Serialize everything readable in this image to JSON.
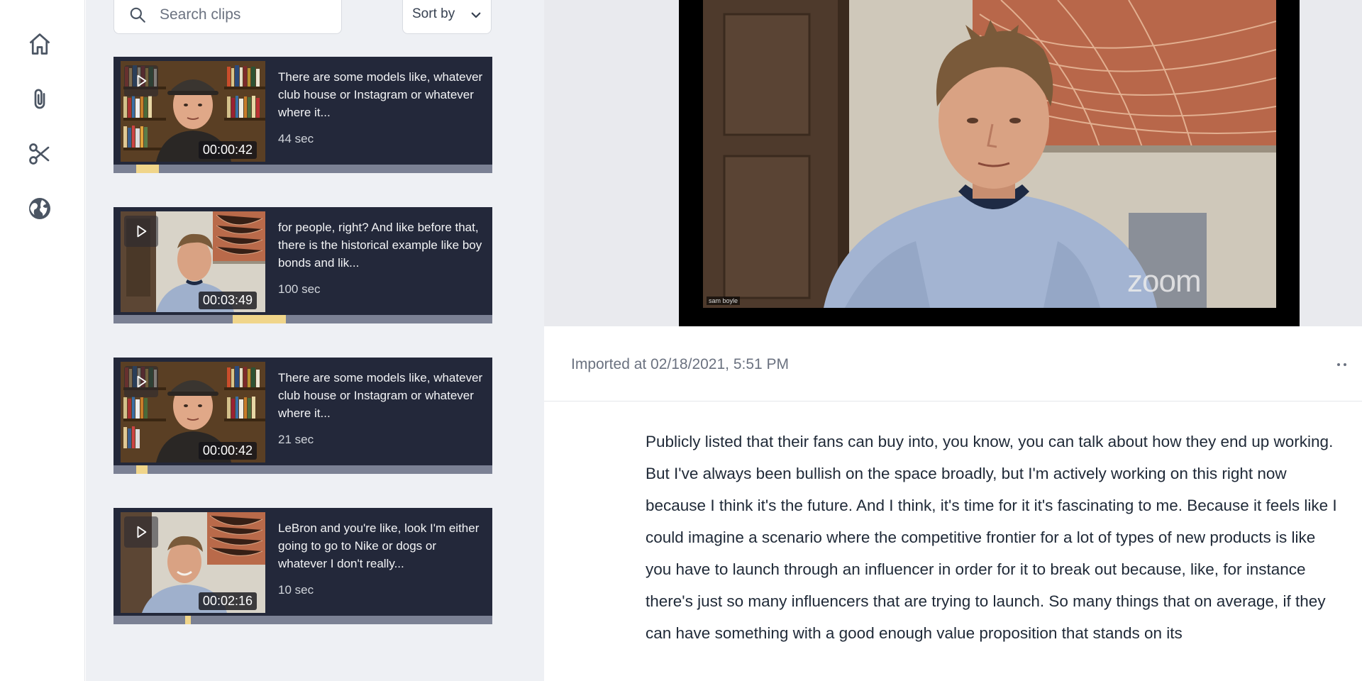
{
  "rail": {
    "items": [
      {
        "icon": "home-icon"
      },
      {
        "icon": "paperclip-icon"
      },
      {
        "icon": "scissors-icon"
      },
      {
        "icon": "globe-icon"
      }
    ]
  },
  "clips_panel": {
    "search": {
      "placeholder": "Search clips",
      "value": ""
    },
    "sort_label": "Sort by",
    "clips": [
      {
        "text": "There are some models like, whatever club house or Instagram or whatever where it...",
        "length": "44 sec",
        "timestamp": "00:00:42",
        "progress_start": 0.06,
        "progress_end": 0.12
      },
      {
        "text": "for people, right? And like before that, there is the historical example like boy bonds and lik...",
        "length": "100 sec",
        "timestamp": "00:03:49",
        "progress_start": 0.315,
        "progress_end": 0.455
      },
      {
        "text": "There are some models like, whatever club house or Instagram or whatever where it...",
        "length": "21 sec",
        "timestamp": "00:00:42",
        "progress_start": 0.06,
        "progress_end": 0.09
      },
      {
        "text": "LeBron and you're like, look I'm either going to go to Nike or dogs or whatever I don't really...",
        "length": "10 sec",
        "timestamp": "00:02:16",
        "progress_start": 0.19,
        "progress_end": 0.205
      }
    ]
  },
  "video": {
    "watermark": "zoom",
    "name_tag": "sam boyle"
  },
  "meta": {
    "imported": "Imported at 02/18/2021, 5:51 PM"
  },
  "transcript": {
    "text": "Publicly listed that their fans can buy into, you know, you can talk about how they end up working. But I've always been bullish on the space broadly, but I'm actively working on this right now because I think it's the future. And I think, it's time for it it's fascinating to me. Because it feels like I could imagine a scenario where the competitive frontier for a lot of types of new products is like you have to launch through an influencer in order for it to break out because, like, for instance there's just so many influencers that are trying to launch. So many things that on average, if they can have something with a good enough value proposition that stands on its"
  },
  "colors": {
    "accent_progress": "#f0d58a",
    "card_bg": "#23283a",
    "panel_bg": "#eef0f4"
  }
}
